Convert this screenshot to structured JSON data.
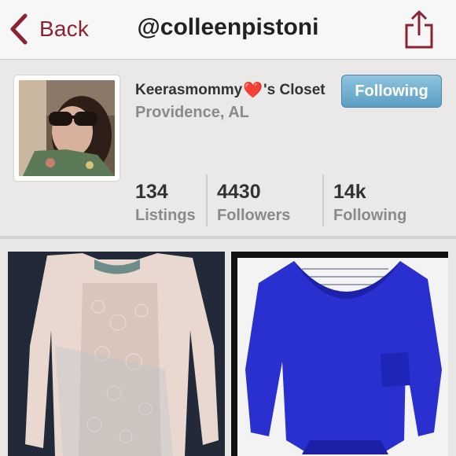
{
  "nav": {
    "back_label": "Back",
    "title": "@colleenpistoni",
    "back_icon": "chevron-left-icon",
    "share_icon": "share-icon"
  },
  "profile": {
    "closet_name_prefix": "Keerasmommy",
    "closet_name_emoji": "❤️",
    "closet_name_suffix": "'s Closet",
    "location": "Providence, AL",
    "follow_button_label": "Following",
    "stats": [
      {
        "value": "134",
        "label": "Listings"
      },
      {
        "value": "4430",
        "label": "Followers"
      },
      {
        "value": "14k",
        "label": "Following"
      }
    ]
  },
  "listings": [
    {
      "image": "white-lace-sweater-photo"
    },
    {
      "image": "blue-dolman-top-photo"
    }
  ],
  "colors": {
    "accent": "#8b2332",
    "follow_button": "#6aa9cb",
    "background": "#e9e7e6"
  }
}
